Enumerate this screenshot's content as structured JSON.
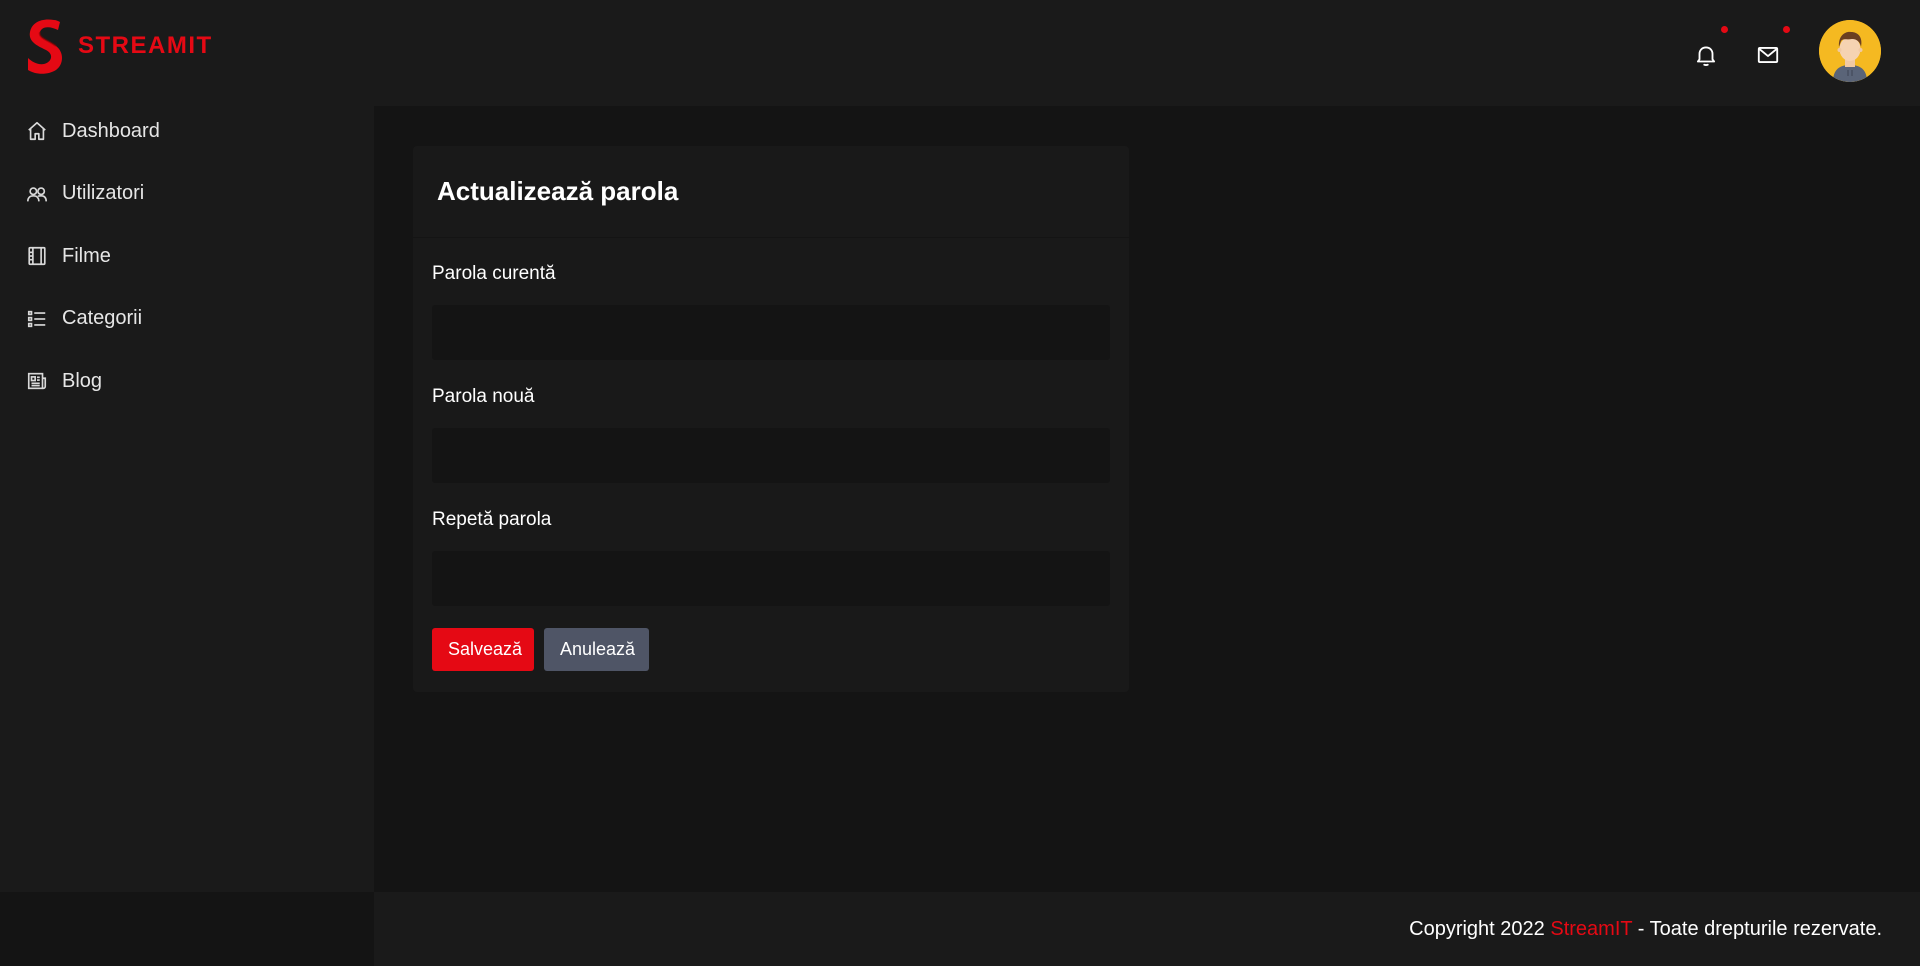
{
  "brand": {
    "name": "STREAMIT",
    "color": "#e50914"
  },
  "sidebar": {
    "items": [
      {
        "label": "Dashboard",
        "icon": "home-icon"
      },
      {
        "label": "Utilizatori",
        "icon": "users-icon"
      },
      {
        "label": "Filme",
        "icon": "film-icon"
      },
      {
        "label": "Categorii",
        "icon": "list-icon"
      },
      {
        "label": "Blog",
        "icon": "newspaper-icon"
      }
    ]
  },
  "header": {
    "notifications_icon": "bell-icon",
    "messages_icon": "mail-icon",
    "avatar_icon": "user-avatar"
  },
  "form": {
    "title": "Actualizează parola",
    "fields": [
      {
        "label": "Parola curentă",
        "value": "",
        "placeholder": ""
      },
      {
        "label": "Parola nouă",
        "value": "",
        "placeholder": ""
      },
      {
        "label": "Repetă parola",
        "value": "",
        "placeholder": ""
      }
    ],
    "save_label": "Salvează",
    "cancel_label": "Anulează"
  },
  "footer": {
    "prefix": "Copyright 2022",
    "brand": "StreamIT",
    "suffix": "- Toate drepturile rezervate."
  },
  "colors": {
    "accent": "#e50914",
    "secondary_button": "#4f5566",
    "background": "#141414",
    "panel": "#1a1a1a"
  }
}
